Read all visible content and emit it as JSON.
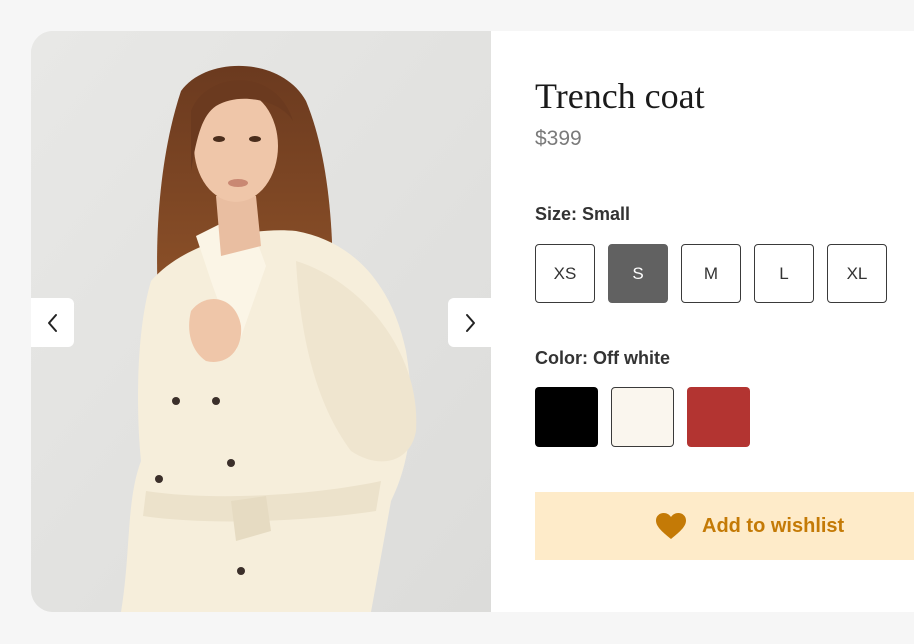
{
  "product": {
    "title": "Trench coat",
    "price": "$399"
  },
  "gallery": {
    "prev_icon": "chevron-left-icon",
    "next_icon": "chevron-right-icon"
  },
  "size": {
    "label": "Size: Small",
    "options": [
      "XS",
      "S",
      "M",
      "L",
      "XL"
    ],
    "selected": "S"
  },
  "color": {
    "label": "Color: Off white",
    "swatches": [
      {
        "name": "Black",
        "hex": "#000000"
      },
      {
        "name": "Off white",
        "hex": "#faf6ee"
      },
      {
        "name": "Red",
        "hex": "#b33431"
      }
    ],
    "selected": "Off white"
  },
  "wishlist": {
    "label": "Add to wishlist",
    "icon": "heart-icon",
    "icon_color": "#c47a06",
    "background": "#feebc9"
  }
}
